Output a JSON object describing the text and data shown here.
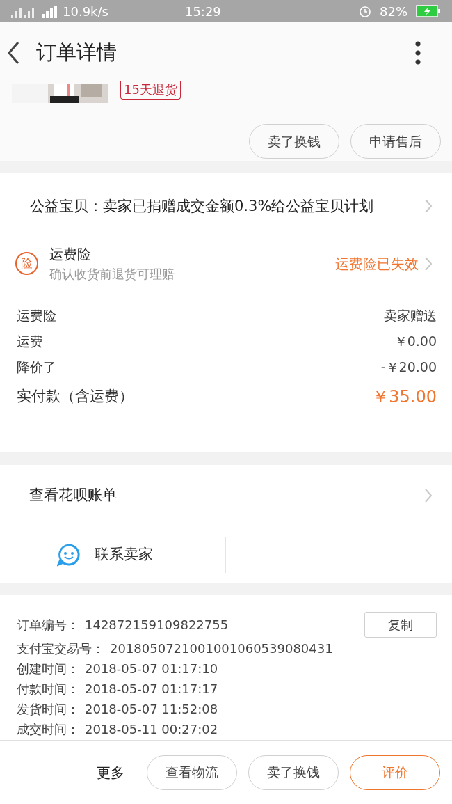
{
  "status_bar": {
    "speed": "10.9k/s",
    "time": "15:29",
    "battery": "82%"
  },
  "header": {
    "title": "订单详情"
  },
  "product": {
    "badge": "15天退货"
  },
  "item_actions": [
    "卖了换钱",
    "申请售后"
  ],
  "charity": {
    "text": "公益宝贝：卖家已捐赠成交金额0.3%给公益宝贝计划"
  },
  "insurance": {
    "icon": "险",
    "title": "运费险",
    "subtitle": "确认收货前退货可理赔",
    "status": "运费险已失效"
  },
  "costs": [
    {
      "label": "运费险",
      "value": "卖家赠送",
      "kind": "plain"
    },
    {
      "label": "运费",
      "value": "￥0.00",
      "kind": "plain"
    },
    {
      "label": "降价了",
      "value": "-￥20.00",
      "kind": "plain"
    },
    {
      "label": "实付款（含运费）",
      "value": "￥35.00",
      "kind": "total"
    }
  ],
  "huabei": {
    "text": "查看花呗账单"
  },
  "contact": {
    "text": "联系卖家"
  },
  "order_info": [
    {
      "label": "订单编号：",
      "value": "142872159109822755",
      "kind": "copy",
      "action": "复制"
    },
    {
      "label": "支付宝交易号：",
      "value": "2018050721001001060539080431",
      "kind": "plain"
    },
    {
      "label": "创建时间：",
      "value": "2018-05-07 01:17:10",
      "kind": "plain"
    },
    {
      "label": "付款时间：",
      "value": "2018-05-07 01:17:17",
      "kind": "plain"
    },
    {
      "label": "发货时间：",
      "value": "2018-05-07 11:52:08",
      "kind": "plain"
    },
    {
      "label": "成交时间：",
      "value": "2018-05-11 00:27:02",
      "kind": "plain"
    }
  ],
  "bottom_bar": {
    "more": "更多",
    "buttons": [
      {
        "label": "查看物流",
        "kind": "plain"
      },
      {
        "label": "卖了换钱",
        "kind": "plain"
      },
      {
        "label": "评价",
        "kind": "primary"
      }
    ]
  }
}
